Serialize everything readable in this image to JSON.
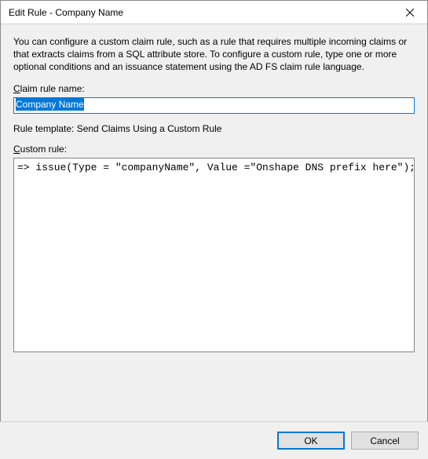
{
  "window": {
    "title": "Edit Rule - Company Name"
  },
  "intro": "You can configure a custom claim rule, such as a rule that requires multiple incoming claims or that extracts claims from a SQL attribute store. To configure a custom rule, type one or more optional conditions and an issuance statement using the AD FS claim rule language.",
  "labels": {
    "claim_rule_name_prefix": "C",
    "claim_rule_name_rest": "laim rule name:",
    "rule_template": "Rule template: Send Claims Using a Custom Rule",
    "custom_rule_prefix": "C",
    "custom_rule_rest": "ustom rule:"
  },
  "fields": {
    "claim_rule_name": "Company Name",
    "custom_rule": "=> issue(Type = \"companyName\", Value =\"Onshape DNS prefix here\");"
  },
  "footer": {
    "ok": "OK",
    "cancel": "Cancel"
  }
}
